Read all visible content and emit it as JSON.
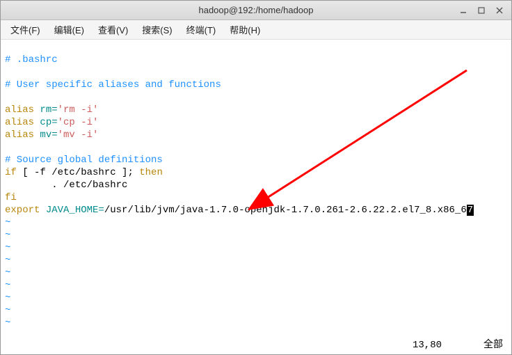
{
  "titlebar": {
    "title": "hadoop@192:/home/hadoop"
  },
  "menubar": {
    "items": [
      "文件(F)",
      "编辑(E)",
      "查看(V)",
      "搜索(S)",
      "终端(T)",
      "帮助(H)"
    ]
  },
  "content": {
    "line1_comment": "# .bashrc",
    "line2_comment": "# User specific aliases and functions",
    "alias1_kw": "alias",
    "alias1_name": " rm=",
    "alias1_val": "'rm -i'",
    "alias2_kw": "alias",
    "alias2_name": " cp=",
    "alias2_val": "'cp -i'",
    "alias3_kw": "alias",
    "alias3_name": " mv=",
    "alias3_val": "'mv -i'",
    "line3_comment": "# Source global definitions",
    "if_kw": "if",
    "if_cond": " [ -f /etc/bashrc ]; ",
    "then_kw": "then",
    "source_line": "        . /etc/bashrc",
    "fi_kw": "fi",
    "export_kw": "export",
    "java_var": " JAVA_HOME=",
    "java_path": "/usr/lib/jvm/java-1.7.0-openjdk-1.7.0.261-2.6.22.2.el7_8.x86_6",
    "cursor_char": "7",
    "tilde": "~"
  },
  "status": {
    "pos": "13,80",
    "mode": "全部"
  }
}
